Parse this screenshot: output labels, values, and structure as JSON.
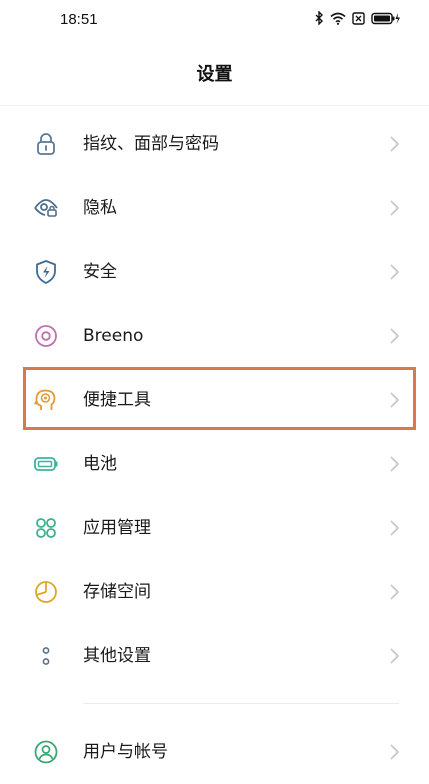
{
  "status_bar": {
    "time": "18:51",
    "icons": [
      "bluetooth-icon",
      "wifi-icon",
      "sim-icon",
      "battery-icon"
    ]
  },
  "header": {
    "title": "设置"
  },
  "settings": [
    {
      "label": "指纹、面部与密码",
      "icon": "lock-icon",
      "color": "#5a7a94"
    },
    {
      "label": "隐私",
      "icon": "eye-privacy-icon",
      "color": "#4d6e8a"
    },
    {
      "label": "安全",
      "icon": "shield-icon",
      "color": "#3d6b96"
    },
    {
      "label": "Breeno",
      "icon": "breeno-icon",
      "color": "#c06fb0"
    },
    {
      "label": "便捷工具",
      "icon": "head-tool-icon",
      "color": "#e29a3a"
    },
    {
      "label": "电池",
      "icon": "battery-setting-icon",
      "color": "#3fb3a0"
    },
    {
      "label": "应用管理",
      "icon": "apps-grid-icon",
      "color": "#3fb08f"
    },
    {
      "label": "存储空间",
      "icon": "storage-pie-icon",
      "color": "#e0a62c"
    },
    {
      "label": "其他设置",
      "icon": "more-dots-icon",
      "color": "#5b6f88"
    }
  ],
  "account": {
    "label": "用户与帐号",
    "icon": "user-account-icon",
    "color": "#3aa774"
  },
  "highlight": {
    "target": "便捷工具",
    "color": "#d9794a"
  }
}
